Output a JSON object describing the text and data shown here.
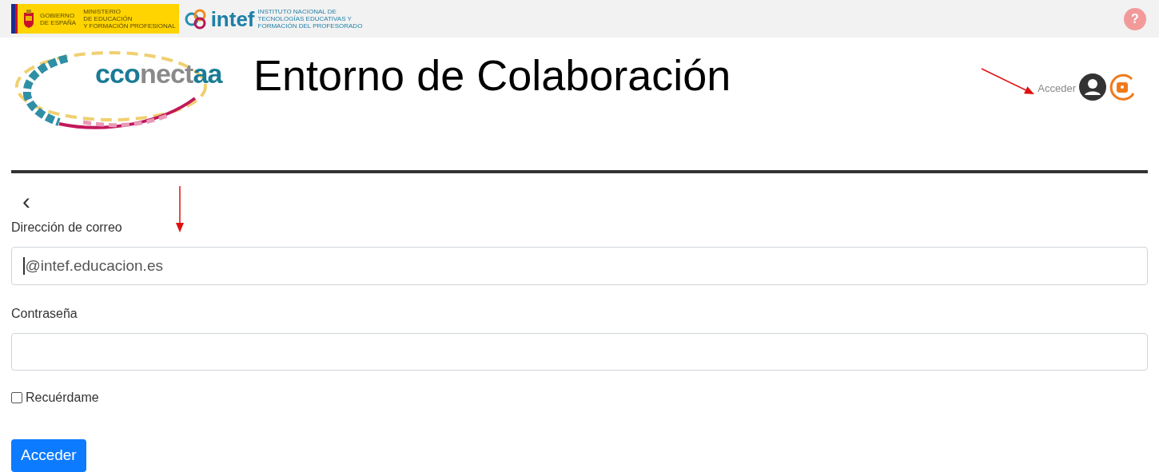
{
  "top_bar": {
    "gov_logo": {
      "line_1": "GOBIERNO",
      "line_2": "DE ESPAÑA"
    },
    "ministry": {
      "line_1": "MINISTERIO",
      "line_2": "DE EDUCACIÓN",
      "line_3": "Y FORMACIÓN PROFESIONAL"
    },
    "intef_logo": {
      "name": "intef",
      "line_1": "INSTITUTO NACIONAL DE",
      "line_2": "TECNOLOGÍAS EDUCATIVAS Y",
      "line_3": "FORMACIÓN DEL PROFESORADO"
    },
    "help": "?"
  },
  "header": {
    "logo_text_1": "cco",
    "logo_text_2": "nect",
    "logo_text_3": "aa",
    "title": "Entorno de Colaboración",
    "login_link": "Acceder"
  },
  "form": {
    "back": "‹",
    "email_label": "Dirección de correo",
    "email_value": "@intef.educacion.es",
    "password_label": "Contraseña",
    "remember": {
      "label": "Recuérdame",
      "checked": false
    },
    "submit": "Acceder"
  }
}
